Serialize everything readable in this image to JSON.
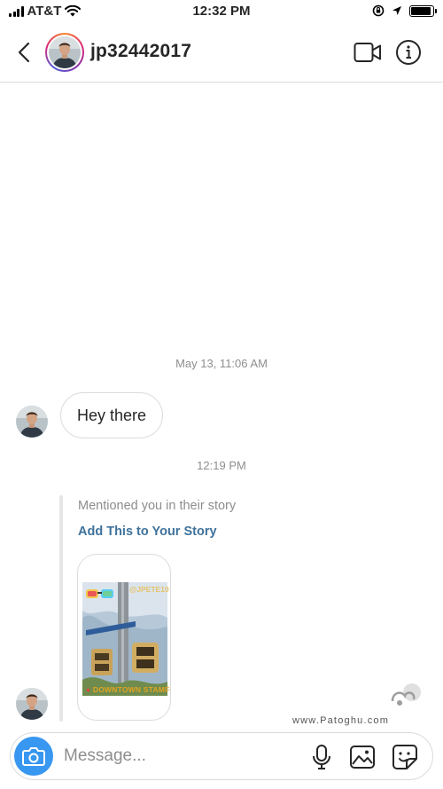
{
  "status_bar": {
    "carrier": "AT&T",
    "time": "12:32 PM",
    "icons": [
      "signal-icon",
      "wifi-icon",
      "orientation-lock-icon",
      "location-arrow-icon",
      "battery-icon"
    ],
    "battery_level": 0.9
  },
  "header": {
    "username": "jp32442017",
    "icons": [
      "back-chevron-icon",
      "video-call-icon",
      "info-icon"
    ]
  },
  "messages": [
    {
      "type": "timestamp",
      "text": "May 13, 11:06 AM"
    },
    {
      "type": "text",
      "sender": "jp32442017",
      "text": "Hey there"
    },
    {
      "type": "timestamp",
      "text": "12:19 PM"
    },
    {
      "type": "story_mention",
      "sender": "jp32442017",
      "caption": "Mentioned you in their story",
      "action": "Add This to Your Story",
      "story_stickers": {
        "handle": "@JPETE10",
        "location": "DOWNTOWN STAMFORD"
      }
    }
  ],
  "watermark": {
    "text": "www.Patoghu.com",
    "logo_icon": "patoghu-logo-icon"
  },
  "composer": {
    "placeholder": "Message...",
    "value": "",
    "icons": [
      "camera-icon",
      "microphone-icon",
      "gallery-icon",
      "sticker-icon"
    ]
  },
  "colors": {
    "accent": "#3897f0",
    "link": "#3f729b",
    "muted": "#8e8e8e",
    "border": "#dbdbdb"
  }
}
